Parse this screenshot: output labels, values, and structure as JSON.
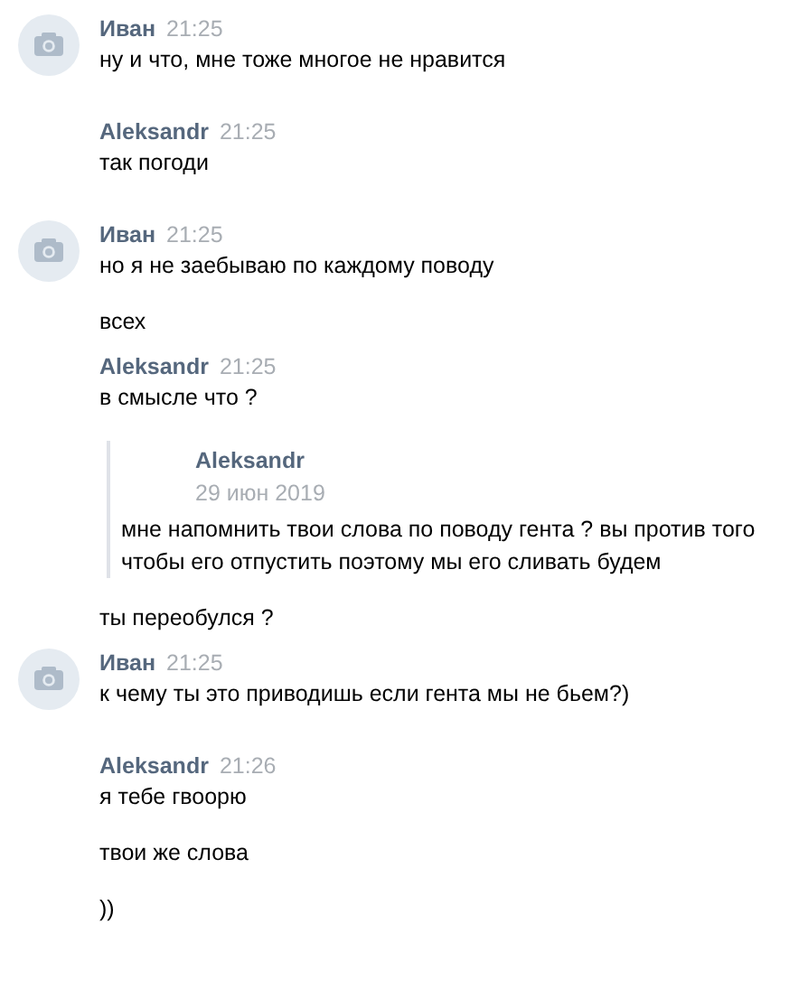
{
  "messages": [
    {
      "author": "Иван",
      "time": "21:25",
      "avatar": true,
      "items": [
        {
          "kind": "text",
          "text": "ну и что, мне тоже многое не нравится"
        }
      ]
    },
    {
      "author": "Aleksandr",
      "time": "21:25",
      "avatar": false,
      "items": [
        {
          "kind": "text",
          "text": "так погоди"
        }
      ]
    },
    {
      "author": "Иван",
      "time": "21:25",
      "avatar": true,
      "items": [
        {
          "kind": "text",
          "text": "но я не заебываю по каждому поводу"
        },
        {
          "kind": "text",
          "text": "всех"
        }
      ]
    },
    {
      "author": "Aleksandr",
      "time": "21:25",
      "avatar": false,
      "items": [
        {
          "kind": "text",
          "text": "в смысле что ?"
        },
        {
          "kind": "quote",
          "author": "Aleksandr",
          "date": "29 июн 2019",
          "text": "мне напомнить твои слова по поводу гента ? вы против того чтобы его отпустить поэтому мы его сливать будем"
        },
        {
          "kind": "text",
          "text": "ты переобулся ?"
        }
      ]
    },
    {
      "author": "Иван",
      "time": "21:25",
      "avatar": true,
      "items": [
        {
          "kind": "text",
          "text": "к чему ты это приводишь если гента мы не бьем?)"
        }
      ]
    },
    {
      "author": "Aleksandr",
      "time": "21:26",
      "avatar": false,
      "items": [
        {
          "kind": "text",
          "text": "я тебе гвоорю"
        },
        {
          "kind": "text",
          "text": "твои же слова"
        },
        {
          "kind": "text",
          "text": "))"
        }
      ]
    }
  ]
}
